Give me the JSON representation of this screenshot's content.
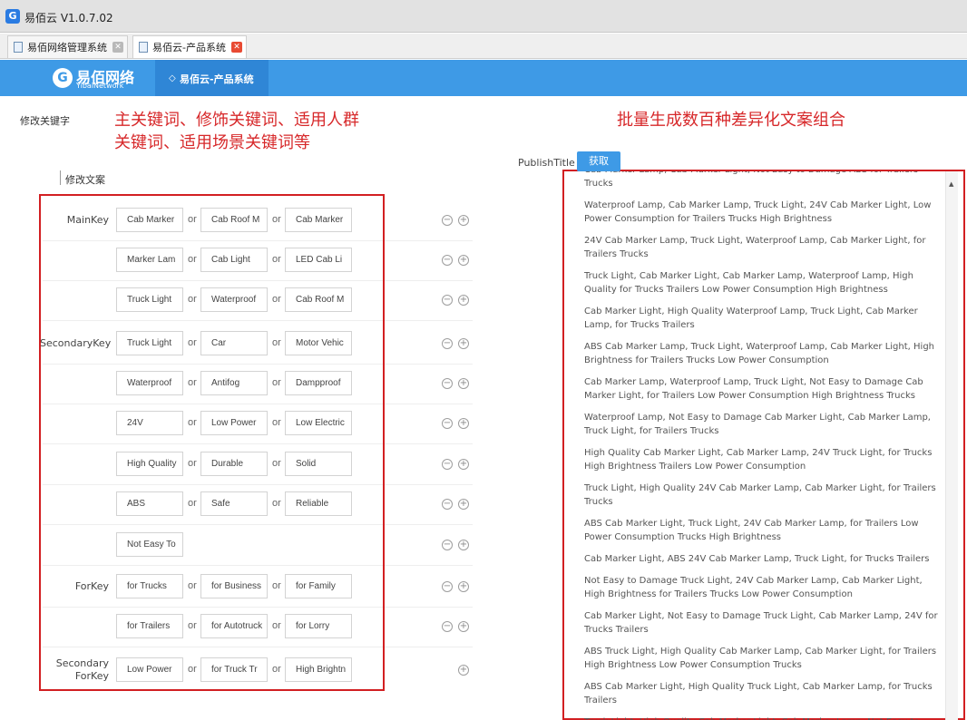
{
  "window": {
    "title": "易佰云 V1.0.7.02",
    "icon": "yibai-logo-icon"
  },
  "tabs": [
    {
      "label": "易佰网络管理系统",
      "active": false
    },
    {
      "label": "易佰云-产品系统",
      "active": true
    }
  ],
  "header": {
    "logo_text": "易佰网络",
    "logo_sub": "YibaiNetwork",
    "nav_item": "易佰云-产品系统"
  },
  "page": {
    "edit_keywords_label": "修改关键字",
    "edit_copy_label": "修改文案"
  },
  "annotations": {
    "left_line1": "主关键词、修饰关键词、适用人群",
    "left_line2": "关键词、适用场景关键词等",
    "right": "批量生成数百种差异化文案组合"
  },
  "form": {
    "or_label": "or",
    "rows": [
      {
        "label": "MainKey",
        "keys": [
          "Cab Marker",
          "Cab Roof M",
          "Cab Marker"
        ],
        "remove": true
      },
      {
        "label": "",
        "keys": [
          "Marker Lam",
          "Cab Light",
          "LED Cab Li"
        ],
        "remove": true
      },
      {
        "label": "",
        "keys": [
          "Truck Light",
          "Waterproof",
          "Cab Roof M"
        ],
        "remove": true
      },
      {
        "label": "SecondaryKey",
        "keys": [
          "Truck Light",
          "Car",
          "Motor Vehic"
        ],
        "remove": true
      },
      {
        "label": "",
        "keys": [
          "Waterproof",
          "Antifog",
          "Dampproof"
        ],
        "remove": true
      },
      {
        "label": "",
        "keys": [
          "24V",
          "Low Power",
          "Low Electric"
        ],
        "remove": true
      },
      {
        "label": "",
        "keys": [
          "High Quality",
          "Durable",
          "Solid"
        ],
        "remove": true
      },
      {
        "label": "",
        "keys": [
          "ABS",
          "Safe",
          "Reliable"
        ],
        "remove": true
      },
      {
        "label": "",
        "keys": [
          "Not Easy To"
        ],
        "remove": true
      },
      {
        "label": "ForKey",
        "keys": [
          "for Trucks",
          "for Business",
          "for Family"
        ],
        "remove": true
      },
      {
        "label": "",
        "keys": [
          "for Trailers",
          "for Autotruck",
          "for Lorry"
        ],
        "remove": true
      },
      {
        "label": "Secondary\nForKey",
        "keys": [
          "Low Power",
          "for Truck Tr",
          "High Brightn"
        ],
        "remove": false
      }
    ]
  },
  "publish": {
    "label": "PublishTitle",
    "fetch_button": "获取",
    "results": [
      "Cab Marker Lamp, Cab Marker Light, Not Easy to Damage ABS for Trailers Trucks",
      "Waterproof Lamp, Cab Marker Lamp, Truck Light, 24V Cab Marker Light, Low Power Consumption for Trailers Trucks High Brightness",
      "24V Cab Marker Lamp, Truck Light, Waterproof Lamp, Cab Marker Light, for Trailers Trucks",
      "Truck Light, Cab Marker Light, Cab Marker Lamp, Waterproof Lamp, High Quality for Trucks Trailers Low Power Consumption High Brightness",
      "Cab Marker Light, High Quality Waterproof Lamp, Truck Light, Cab Marker Lamp, for Trucks Trailers",
      "ABS Cab Marker Lamp, Truck Light, Waterproof Lamp, Cab Marker Light, High Brightness for Trailers Trucks Low Power Consumption",
      "Cab Marker Lamp, Waterproof Lamp, Truck Light, Not Easy to Damage Cab Marker Light, for Trailers Low Power Consumption High Brightness Trucks",
      "Waterproof Lamp, Not Easy to Damage Cab Marker Light, Cab Marker Lamp, Truck Light, for Trailers Trucks",
      "High Quality Cab Marker Light, Cab Marker Lamp, 24V Truck Light, for Trucks High Brightness Trailers Low Power Consumption",
      "Truck Light, High Quality 24V Cab Marker Lamp, Cab Marker Light, for Trailers Trucks",
      "ABS Cab Marker Light, Truck Light, 24V Cab Marker Lamp, for Trailers Low Power Consumption Trucks High Brightness",
      "Cab Marker Light, ABS 24V Cab Marker Lamp, Truck Light, for Trucks Trailers",
      "Not Easy to Damage Truck Light, 24V Cab Marker Lamp, Cab Marker Light, High Brightness for Trailers Trucks Low Power Consumption",
      "Cab Marker Light, Not Easy to Damage Truck Light, Cab Marker Lamp, 24V for Trucks Trailers",
      "ABS Truck Light, High Quality Cab Marker Lamp, Cab Marker Light, for Trailers High Brightness Low Power Consumption Trucks",
      "ABS Cab Marker Light, High Quality Truck Light, Cab Marker Lamp, for Trucks Trailers",
      "Truck Light, High Quality Cab Marker Light, Cab Marker Lamp, Not Easy to Damage"
    ]
  },
  "colors": {
    "accent": "#3e9ae6",
    "annotation": "#d7282a",
    "highlight_box": "#d21f22"
  }
}
